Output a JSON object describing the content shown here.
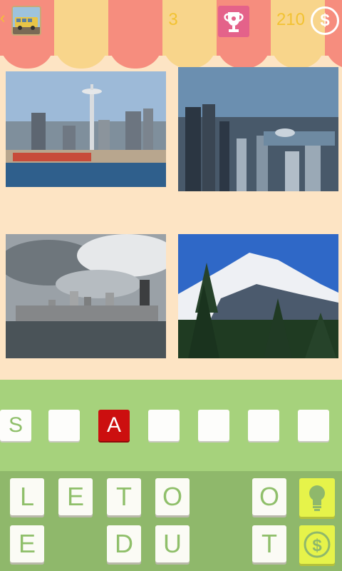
{
  "header": {
    "back_icon": "chevron-left-icon",
    "level_thumbnail_icon": "bus-thumbnail-icon",
    "level": "3",
    "trophy_icon": "trophy-icon",
    "coins": "210",
    "coin_icon": "dollar-coin-icon",
    "colors": {
      "awning_red": "#f68d7e",
      "awning_yellow": "#f8d58b",
      "gold": "#f2c232",
      "trophy_bg": "#e4628a"
    }
  },
  "photos": [
    {
      "subject": "Space Needle skyline over water"
    },
    {
      "subject": "Downtown skyline aerial at dusk"
    },
    {
      "subject": "Skyline under cloudy sky"
    },
    {
      "subject": "Snow-capped mountain with evergreens"
    }
  ],
  "answer": {
    "slots": [
      "S",
      "",
      "A",
      "",
      "",
      "",
      ""
    ],
    "highlighted_index": 2,
    "colors": {
      "bar": "#a6d27c",
      "highlight": "#cc0f0f"
    }
  },
  "keyboard": {
    "row1": [
      "L",
      "E",
      "T",
      "O",
      "",
      "O"
    ],
    "row2": [
      "E",
      "",
      "D",
      "U",
      "",
      "T"
    ],
    "hint_icon": "lightbulb-icon",
    "buy_icon": "dollar-coin-icon",
    "colors": {
      "panel": "#8fb86b",
      "hint": "#e6f34a"
    }
  }
}
